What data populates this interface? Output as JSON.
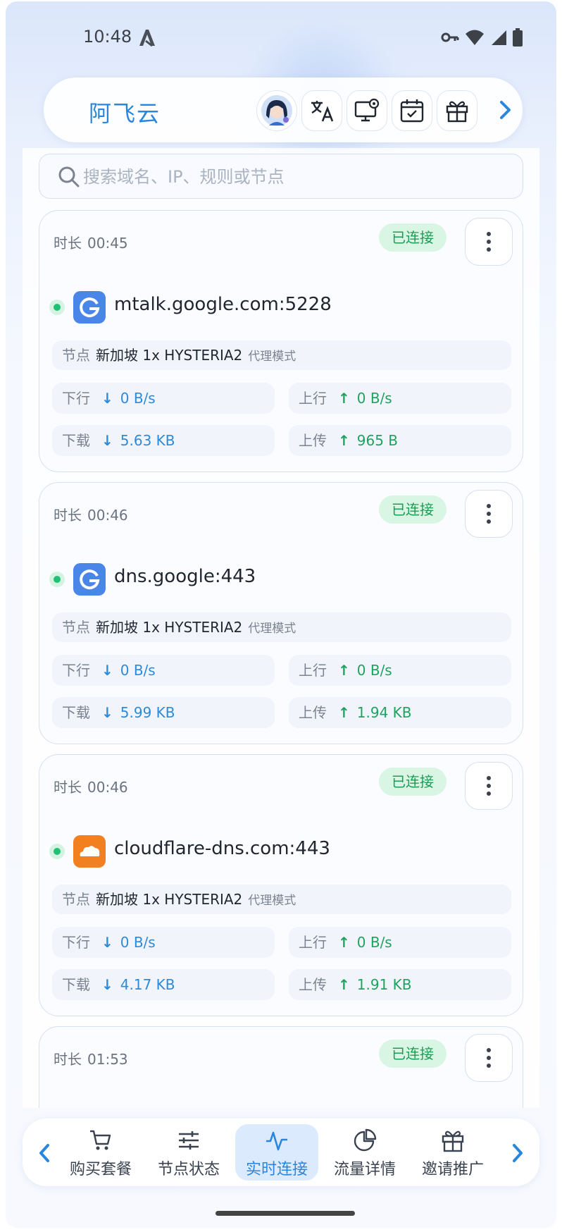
{
  "status_bar": {
    "time": "10:48",
    "icons": [
      "accessibility-icon",
      "vpn-key-icon",
      "wifi-icon",
      "signal-icon",
      "battery-icon"
    ]
  },
  "header": {
    "app_title": "阿飞云",
    "toolbar_icons": [
      "avatar-icon",
      "translate-icon",
      "monitor-settings-icon",
      "calendar-check-icon",
      "gift-icon",
      "chevron-right-icon"
    ]
  },
  "search": {
    "placeholder": "搜索域名、IP、规则或节点"
  },
  "labels": {
    "duration": "时长",
    "connected": "已连接",
    "node": "节点",
    "proxy_mode": "代理模式",
    "down_rate": "下行",
    "up_rate": "上行",
    "downloaded": "下载",
    "uploaded": "上传"
  },
  "connections": [
    {
      "duration": "00:45",
      "status": "已连接",
      "icon": "google-icon",
      "host": "mtalk.google.com:5228",
      "node": "新加坡 1x HYSTERIA2",
      "mode": "代理模式",
      "down_rate": "0 B/s",
      "up_rate": "0 B/s",
      "downloaded": "5.63 KB",
      "uploaded": "965 B"
    },
    {
      "duration": "00:46",
      "status": "已连接",
      "icon": "google-icon",
      "host": "dns.google:443",
      "node": "新加坡 1x HYSTERIA2",
      "mode": "代理模式",
      "down_rate": "0 B/s",
      "up_rate": "0 B/s",
      "downloaded": "5.99 KB",
      "uploaded": "1.94 KB"
    },
    {
      "duration": "00:46",
      "status": "已连接",
      "icon": "cloudflare-icon",
      "host": "cloudflare-dns.com:443",
      "node": "新加坡 1x HYSTERIA2",
      "mode": "代理模式",
      "down_rate": "0 B/s",
      "up_rate": "0 B/s",
      "downloaded": "4.17 KB",
      "uploaded": "1.91 KB"
    },
    {
      "duration": "01:53",
      "status": "已连接"
    }
  ],
  "bottom_nav": {
    "items": [
      {
        "label": "购买套餐",
        "icon": "cart-icon",
        "active": false
      },
      {
        "label": "节点状态",
        "icon": "sliders-icon",
        "active": false
      },
      {
        "label": "实时连接",
        "icon": "activity-icon",
        "active": true
      },
      {
        "label": "流量详情",
        "icon": "pie-chart-icon",
        "active": false
      },
      {
        "label": "邀请推广",
        "icon": "gift-icon",
        "active": false
      }
    ]
  },
  "colors": {
    "accent": "#2a86db",
    "connected_bg": "#d9f5e3",
    "connected_text": "#1e9b55",
    "download": "#2d8ad9",
    "upload": "#1fa260",
    "google_blue": "#4a86e8",
    "cloudflare_orange": "#f38020"
  }
}
